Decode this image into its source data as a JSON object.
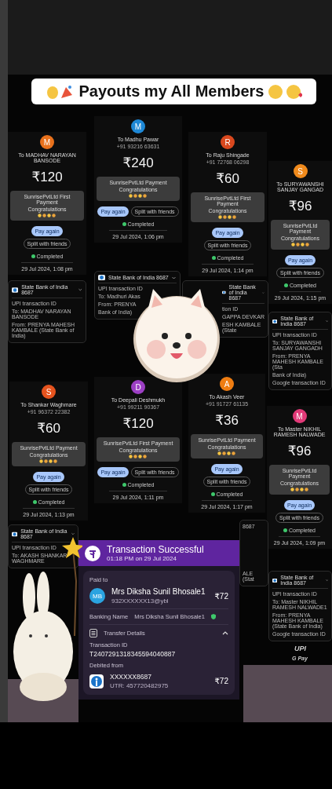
{
  "banner": {
    "title": "Payouts my All Members"
  },
  "payments": [
    {
      "initial": "M",
      "color": "#e8711c",
      "name": "To MADHAV NARAYAN BANSODE",
      "amount": "₹120",
      "note": "SunrisePvtLtd First Payment",
      "congrats": "Congratulations",
      "pay_again": "Pay again",
      "split": "Split with friends",
      "status": "Completed",
      "date": "29 Jul 2024, 1:08 pm"
    },
    {
      "initial": "M",
      "color": "#1e88d6",
      "name": "To Madhu Pawar",
      "phone": "+91 93216 63631",
      "amount": "₹240",
      "note": "SunrisePvtLtd Payment",
      "congrats": "Congratulations",
      "pay_again": "Pay again",
      "split": "Split with friends",
      "status": "Completed",
      "date": "29 Jul 2024, 1:06 pm"
    },
    {
      "initial": "R",
      "color": "#d9481e",
      "name": "To Raju Shingade",
      "phone": "+91 72768 06298",
      "amount": "₹60",
      "note": "SunrisePvtLtd First Payment",
      "congrats": "Congratulations",
      "pay_again": "Pay again",
      "split": "Split with friends",
      "status": "Completed",
      "date": "29 Jul 2024, 1:14 pm"
    },
    {
      "initial": "S",
      "color": "#f08a1c",
      "name": "To SURYAWANSHI SANJAY GANGAD",
      "amount": "₹96",
      "note": "SunrisePvtLtd Payment",
      "congrats": "Congratulations",
      "pay_again": "Pay again",
      "split": "Split with friends",
      "status": "Completed",
      "date": "29 Jul 2024, 1:15 pm"
    },
    {
      "initial": "S",
      "color": "#e5531e",
      "name": "To Shankar Waghmare",
      "phone": "+91 96372 22382",
      "amount": "₹60",
      "note": "SunrisePvtLtd Payment",
      "congrats": "Congratulations",
      "pay_again": "Pay again",
      "split": "Split with friends",
      "status": "Completed",
      "date": "29 Jul 2024, 1:13 pm"
    },
    {
      "initial": "D",
      "color": "#9c3fc4",
      "name": "To Deepali Deshmukh",
      "phone": "+91 99211 90367",
      "amount": "₹120",
      "note": "SunrisePvtLtd First Payment",
      "congrats": "Congratulations",
      "pay_again": "Pay again",
      "split": "Split with friends",
      "status": "Completed",
      "date": "29 Jul 2024, 1:11 pm"
    },
    {
      "initial": "A",
      "color": "#ef7d12",
      "name": "To Akash Veer",
      "phone": "+91 91727 61135",
      "amount": "₹36",
      "note": "SunrisePvtLtd Payment",
      "congrats": "Congratulations",
      "pay_again": "Pay again",
      "split": "Split with friends",
      "status": "Completed",
      "date": "29 Jul 2024, 1:17 pm"
    },
    {
      "initial": "M",
      "color": "#e23a78",
      "name": "To Master NIKHIL RAMESH NALWADE",
      "amount": "₹96",
      "note": "SunrisePvtLtd Payment",
      "congrats": "Congratulations",
      "pay_again": "Pay again",
      "split": "Split with friends",
      "status": "Completed",
      "date": "29 Jul 2024, 1:09 pm"
    }
  ],
  "bank_cards": [
    {
      "header": "State Bank of India 8687",
      "lines": [
        "UPI transaction ID",
        "To: MADHAV NARAYAN BANSODE",
        "From: PRENYA MAHESH KAMBALE (State Bank of India)"
      ]
    },
    {
      "header": "State Bank of India 8687",
      "lines": [
        "UPI transaction ID",
        "To: Madhuri Akas",
        "From: PRENYA",
        "Bank of India)"
      ]
    },
    {
      "header": "State Bank of India 8687",
      "lines": [
        "tion ID",
        "GAPPA DEVKAR",
        "ESH KAMBALE (State"
      ]
    },
    {
      "header": "State Bank of India 8687",
      "lines": [
        "UPI transaction ID",
        "To: SURYAWANSHI SANJAY GANGADH",
        "From: PRENYA MAHESH KAMBALE (Sta",
        "Bank of India)",
        "Google transaction ID"
      ]
    },
    {
      "header": "State Bank of India 8687",
      "lines": [
        "UPI transaction ID",
        "To: AKASH SHANKAR WAGHMARE"
      ]
    },
    {
      "header": "State Bank of India 8687",
      "lines": [
        "UPI transaction ID",
        "To: Master NIKHIL RAMESH NALWADE1",
        "From: PRENYA MAHESH KAMBALE (State Bank of India)",
        "Google transaction ID"
      ]
    },
    {
      "lines": [
        "8687",
        "ALE (Stat"
      ]
    }
  ],
  "upi_label": "UPI",
  "gpay_label": "G Pay",
  "receipt": {
    "title": "Transaction Successful",
    "time": "01:18 PM on 29 Jul 2024",
    "paid_to": "Paid to",
    "initials": "MB",
    "payee": "Mrs Diksha Sunil Bhosale1",
    "amount": "₹72",
    "upi_id": "932XXXXXX13@ybl",
    "banking_name_label": "Banking Name",
    "banking_name": "Mrs Diksha Sunil Bhosale1",
    "details_title": "Transfer Details",
    "expanded": true,
    "txn_label": "Transaction ID",
    "txn_id": "T2407291318345594040887",
    "debited_label": "Debited from",
    "account": "XXXXXX8687",
    "debit_amount": "₹72",
    "utr": "UTR: 457720482975"
  }
}
